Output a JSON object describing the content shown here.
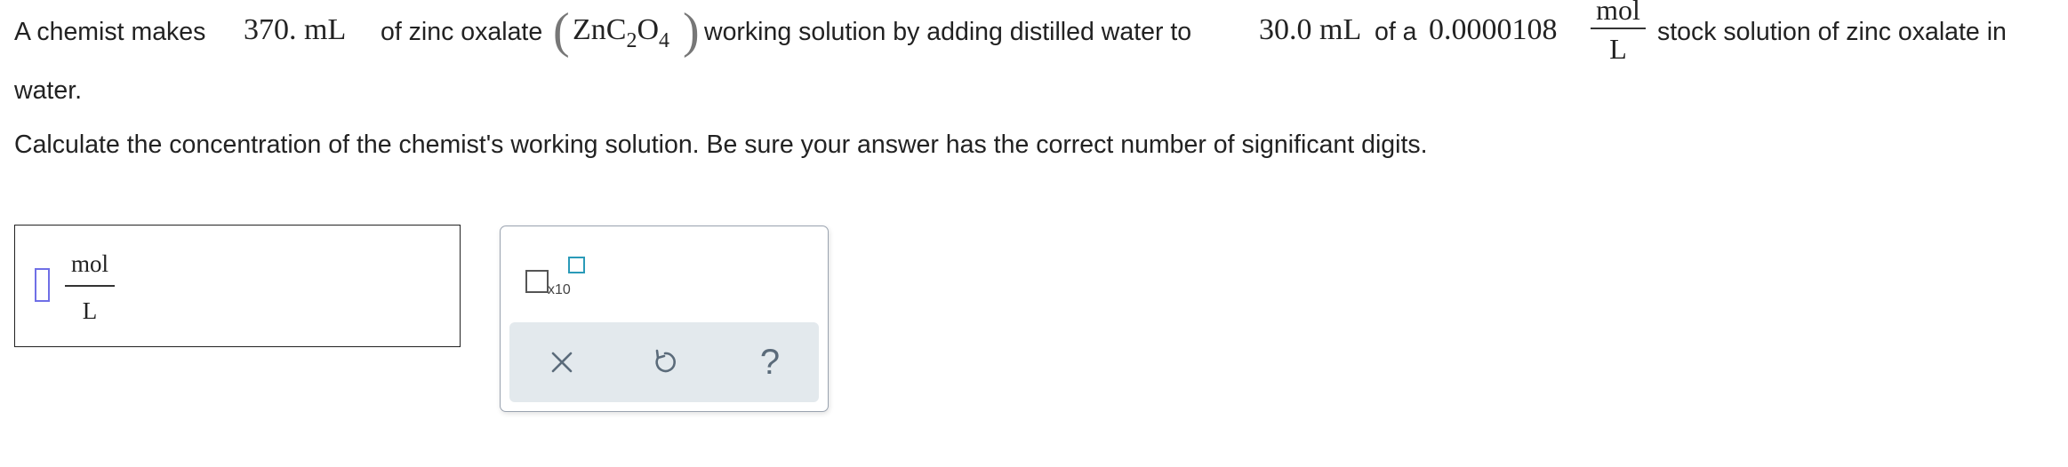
{
  "problem": {
    "intro": "A chemist makes",
    "volume_final": "370. mL",
    "text_of_zinc": "of zinc oxalate",
    "formula": {
      "main": "ZnC",
      "sub1": "2",
      "mid": "O",
      "sub2": "4"
    },
    "text_working": "working solution by adding distilled water to",
    "volume_stock": "30.0 mL",
    "text_of_a": "of a",
    "stock_concentration": "0.0000108",
    "unit_numerator": "mol",
    "unit_denominator": "L",
    "text_stock_end": "stock solution of zinc oxalate in",
    "text_water": "water.",
    "instruction": "Calculate the concentration of the chemist's working solution. Be sure your answer has the correct number of significant digits."
  },
  "answer": {
    "value": "",
    "unit_numerator": "mol",
    "unit_denominator": "L"
  },
  "tools": {
    "x10_label": "x10",
    "clear_icon": "close-icon",
    "undo_icon": "undo-icon",
    "help_label": "?"
  },
  "colors": {
    "input_border": "#6f6fe6",
    "exponent_box": "#2a9ab8",
    "action_bar": "#e3e9ed",
    "icon": "#5b6b7a"
  }
}
